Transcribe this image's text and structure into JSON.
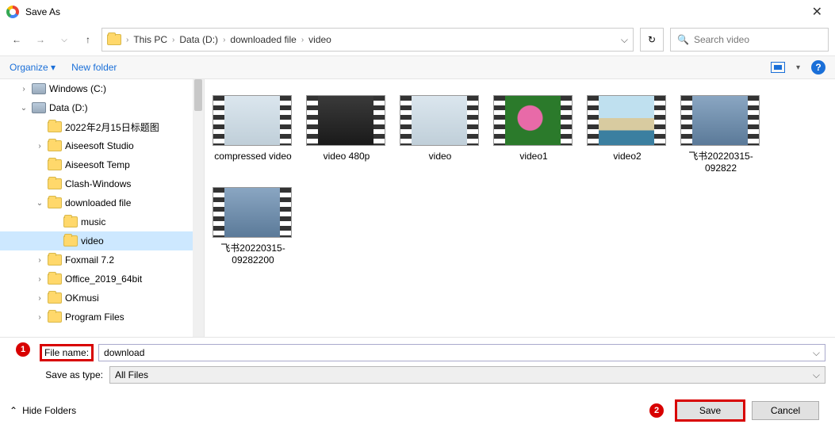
{
  "title": "Save As",
  "nav": {
    "breadcrumbs": [
      "This PC",
      "Data (D:)",
      "downloaded file",
      "video"
    ],
    "search_placeholder": "Search video"
  },
  "toolbar": {
    "organize": "Organize",
    "new_folder": "New folder"
  },
  "tree": [
    {
      "label": "Windows (C:)",
      "icon": "disk",
      "indent": 1,
      "expander": ">"
    },
    {
      "label": "Data (D:)",
      "icon": "disk",
      "indent": 1,
      "expander": "v"
    },
    {
      "label": "2022年2月15日标题图",
      "icon": "folder",
      "indent": 2,
      "expander": ""
    },
    {
      "label": "Aiseesoft Studio",
      "icon": "folder",
      "indent": 2,
      "expander": ">"
    },
    {
      "label": "Aiseesoft Temp",
      "icon": "folder",
      "indent": 2,
      "expander": ""
    },
    {
      "label": "Clash-Windows",
      "icon": "folder",
      "indent": 2,
      "expander": ""
    },
    {
      "label": "downloaded file",
      "icon": "folder",
      "indent": 2,
      "expander": "v"
    },
    {
      "label": "music",
      "icon": "folder",
      "indent": 3,
      "expander": ""
    },
    {
      "label": "video",
      "icon": "folder",
      "indent": 3,
      "expander": "",
      "selected": true
    },
    {
      "label": "Foxmail 7.2",
      "icon": "folder",
      "indent": 2,
      "expander": ">"
    },
    {
      "label": "Office_2019_64bit",
      "icon": "folder",
      "indent": 2,
      "expander": ">"
    },
    {
      "label": "OKmusi",
      "icon": "folder",
      "indent": 2,
      "expander": ">"
    },
    {
      "label": "Program Files",
      "icon": "folder",
      "indent": 2,
      "expander": ">"
    }
  ],
  "files": [
    {
      "label": "compressed video",
      "bg": "linear-gradient(#dbe6ee,#c0cfd9)"
    },
    {
      "label": "video 480p",
      "bg": "linear-gradient(#3a3a3a,#1a1a1a)"
    },
    {
      "label": "video",
      "bg": "linear-gradient(#dbe6ee,#c0cfd9)"
    },
    {
      "label": "video1",
      "bg": "radial-gradient(circle at 45% 45%, #e86aa8 0 30%, #2b7a2b 32% 100%)"
    },
    {
      "label": "video2",
      "bg": "linear-gradient(#bfe0ef 0 45%, #d8cba0 45% 70%, #3b7fa0 70% 100%)"
    },
    {
      "label": "飞书20220315-092822",
      "bg": "linear-gradient(#8aa6c2,#5b7a99)"
    },
    {
      "label": "飞书20220315-09282200",
      "bg": "linear-gradient(#8aa6c2,#5b7a99)"
    }
  ],
  "form": {
    "filename_label": "File name:",
    "filename_value": "download",
    "type_label": "Save as type:",
    "type_value": "All Files"
  },
  "buttons": {
    "save": "Save",
    "cancel": "Cancel",
    "hide_folders": "Hide Folders"
  },
  "callouts": {
    "one": "1",
    "two": "2"
  }
}
